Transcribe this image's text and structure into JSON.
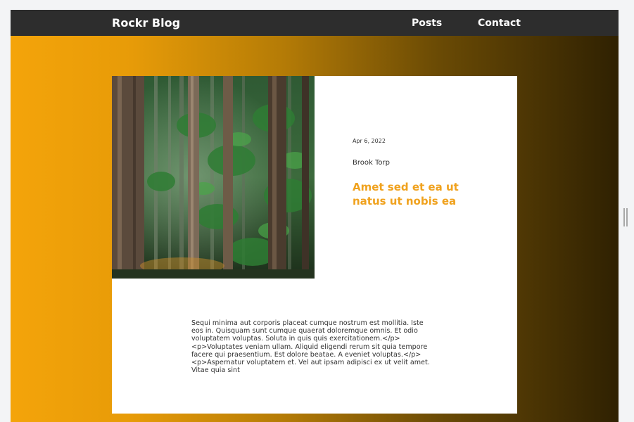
{
  "navbar": {
    "brand": "Rockr Blog",
    "links": [
      {
        "label": "Posts"
      },
      {
        "label": "Contact"
      }
    ]
  },
  "post": {
    "image_alt": "forest",
    "date": "Apr 6, 2022",
    "author": "Brook Torp",
    "title": "Amet sed et ea ut natus ut nobis ea",
    "body": "Sequi minima aut corporis placeat cumque nostrum est mollitia. Iste eos in. Quisquam sunt cumque quaerat doloremque omnis. Et odio voluptatem voluptas. Soluta in quis quis exercitationem.</p>\n<p>Voluptates veniam ullam. Aliquid eligendi rerum sit quia tempore facere qui praesentium. Est dolore beatae. A eveniet voluptas.</p>\n<p>Aspernatur voluptatem et. Vel aut ipsam adipisci ex ut velit amet. Vitae quia sint"
  },
  "colors": {
    "accent": "#f0a21e",
    "navbar": "#2d2d2d",
    "gradient_start": "#f4a40a",
    "gradient_end": "#2f2102"
  }
}
